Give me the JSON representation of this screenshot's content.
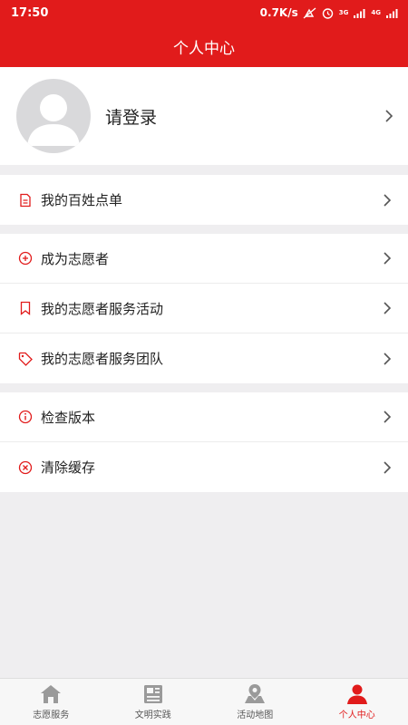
{
  "status_bar": {
    "time": "17:50",
    "speed": "0.7K/s",
    "signal1_label": "3G",
    "signal2_label": "4G"
  },
  "header": {
    "title": "个人中心"
  },
  "profile": {
    "login_label": "请登录"
  },
  "groups": [
    {
      "items": [
        {
          "label": "我的百姓点单",
          "icon": "document-icon"
        }
      ]
    },
    {
      "items": [
        {
          "label": "成为志愿者",
          "icon": "plus-circle-icon"
        },
        {
          "label": "我的志愿者服务活动",
          "icon": "bookmark-icon"
        },
        {
          "label": "我的志愿者服务团队",
          "icon": "tag-icon"
        }
      ]
    },
    {
      "items": [
        {
          "label": "检查版本",
          "icon": "info-circle-icon"
        },
        {
          "label": "清除缓存",
          "icon": "close-circle-icon"
        }
      ]
    }
  ],
  "tabbar": {
    "tabs": [
      {
        "label": "志愿服务",
        "icon": "home-icon",
        "active": false
      },
      {
        "label": "文明实践",
        "icon": "news-icon",
        "active": false
      },
      {
        "label": "活动地图",
        "icon": "map-icon",
        "active": false
      },
      {
        "label": "个人中心",
        "icon": "person-icon",
        "active": true
      }
    ]
  },
  "colors": {
    "accent": "#e11b1b",
    "background": "#efeef0"
  }
}
